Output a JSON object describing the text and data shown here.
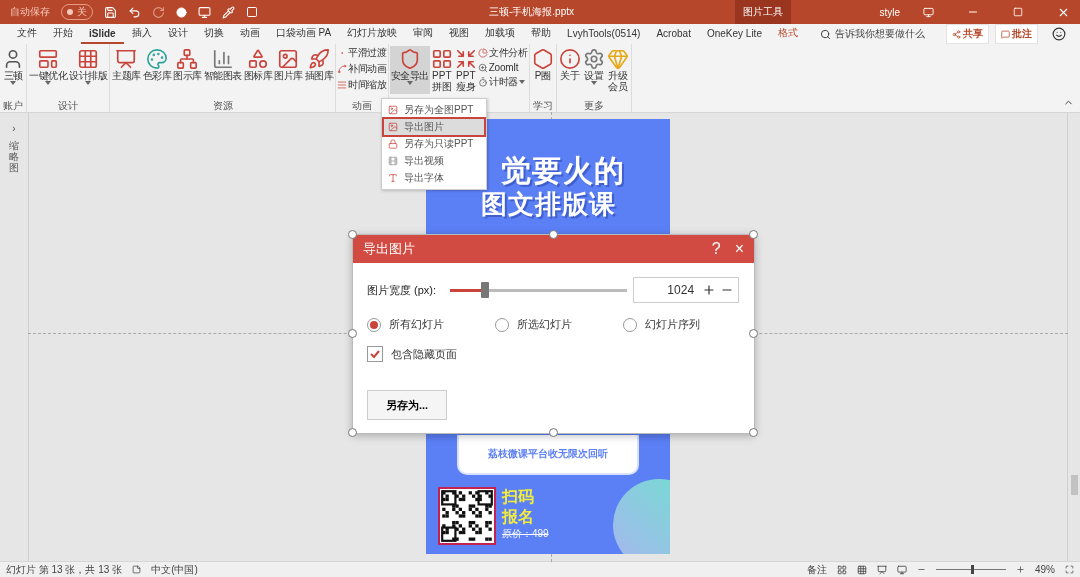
{
  "title_bar": {
    "autosave_label": "自动保存",
    "autosave_toggle": {
      "label": "关",
      "on": false
    },
    "document_title": "三顿-手机海报.pptx",
    "context_label": "图片工具",
    "user": "style"
  },
  "tabs": [
    {
      "label": "文件",
      "selected": false,
      "kind": "normal"
    },
    {
      "label": "开始",
      "selected": false,
      "kind": "normal"
    },
    {
      "label": "iSlide",
      "selected": true,
      "kind": "normal"
    },
    {
      "label": "插入",
      "selected": false,
      "kind": "normal"
    },
    {
      "label": "设计",
      "selected": false,
      "kind": "normal"
    },
    {
      "label": "切换",
      "selected": false,
      "kind": "normal"
    },
    {
      "label": "动画",
      "selected": false,
      "kind": "normal"
    },
    {
      "label": "口袋动画 PA",
      "selected": false,
      "kind": "normal"
    },
    {
      "label": "幻灯片放映",
      "selected": false,
      "kind": "normal"
    },
    {
      "label": "审阅",
      "selected": false,
      "kind": "normal"
    },
    {
      "label": "视图",
      "selected": false,
      "kind": "normal"
    },
    {
      "label": "加载项",
      "selected": false,
      "kind": "normal"
    },
    {
      "label": "帮助",
      "selected": false,
      "kind": "normal"
    },
    {
      "label": "LvyhTools(0514)",
      "selected": false,
      "kind": "normal"
    },
    {
      "label": "Acrobat",
      "selected": false,
      "kind": "normal"
    },
    {
      "label": "OneKey Lite",
      "selected": false,
      "kind": "normal"
    },
    {
      "label": "格式",
      "selected": false,
      "kind": "context"
    }
  ],
  "search": {
    "placeholder": "告诉我你想要做什么"
  },
  "actions": [
    "共享",
    "批注"
  ],
  "ribbon": {
    "groups": [
      {
        "label": "账户",
        "items": [
          {
            "label": "三顿",
            "kind": "large",
            "dropdown": true
          }
        ]
      },
      {
        "label": "设计",
        "items": [
          {
            "label": "一键优化",
            "kind": "large",
            "dropdown": true
          },
          {
            "label": "设计排版",
            "kind": "large",
            "dropdown": true
          }
        ]
      },
      {
        "label": "资源",
        "items": [
          {
            "label": "主题库",
            "kind": "large",
            "dropdown": false
          },
          {
            "label": "色彩库",
            "kind": "large",
            "dropdown": false
          },
          {
            "label": "图示库",
            "kind": "large",
            "dropdown": false
          },
          {
            "label": "智能图表",
            "kind": "large",
            "dropdown": false
          },
          {
            "label": "图标库",
            "kind": "large",
            "dropdown": false
          },
          {
            "label": "图片库",
            "kind": "large",
            "dropdown": false
          },
          {
            "label": "插图库",
            "kind": "large",
            "dropdown": false
          }
        ]
      },
      {
        "label": "动画",
        "items": [
          {
            "label": "平滑过渡",
            "kind": "small",
            "dropdown": false
          },
          {
            "label": "补间动画",
            "kind": "small",
            "dropdown": false
          },
          {
            "label": "时间缩放",
            "kind": "small",
            "dropdown": false
          }
        ]
      },
      {
        "items": [
          {
            "label": "安全导出",
            "kind": "large",
            "dropdown": true,
            "selected": true
          },
          {
            "label": "PPT拼图",
            "kind": "large",
            "dropdown": false,
            "selected": false
          },
          {
            "label": "PPT瘦身",
            "kind": "large",
            "dropdown": false,
            "selected": false
          },
          {
            "label": "文件分析",
            "kind": "small",
            "dropdown": false
          },
          {
            "label": "ZoomIt",
            "kind": "small",
            "dropdown": false
          },
          {
            "label": "计时器",
            "kind": "small",
            "dropdown": true
          }
        ]
      },
      {
        "label": "学习",
        "items": [
          {
            "label": "P圈",
            "kind": "large",
            "dropdown": false
          }
        ]
      },
      {
        "label": "更多",
        "items": [
          {
            "label": "关于",
            "kind": "large",
            "dropdown": false
          },
          {
            "label": "设置",
            "kind": "large",
            "dropdown": true
          },
          {
            "label": "升级会员",
            "kind": "large",
            "dropdown": false
          }
        ]
      }
    ]
  },
  "dropdown_menu": {
    "items": [
      {
        "label": "另存为全图PPT",
        "selected": false
      },
      {
        "label": "导出图片",
        "selected": true
      },
      {
        "label": "另存为只读PPT",
        "selected": false
      },
      {
        "label": "导出视频",
        "selected": false
      },
      {
        "label": "导出字体",
        "selected": false
      }
    ]
  },
  "thumbnail_strip": {
    "toggle": "›",
    "label": "缩略图"
  },
  "slide": {
    "headline": [
      "觉要火的",
      "图文排版课"
    ],
    "card_note": "荔枝微课平台收无限次回听",
    "cta": [
      "扫码",
      "报名"
    ],
    "price": "原价：499"
  },
  "dialog": {
    "title": "导出图片",
    "help": "?",
    "close": "×",
    "width_label": "图片宽度 (px):",
    "width_slider": {
      "level": 0.2
    },
    "width_value": "1024",
    "radios": [
      {
        "label": "所有幻灯片",
        "selected": true
      },
      {
        "label": "所选幻灯片",
        "selected": false
      },
      {
        "label": "幻灯片序列",
        "selected": false
      }
    ],
    "checkbox": {
      "label": "包含隐藏页面",
      "checked": true
    },
    "save_button": "另存为..."
  },
  "status_bar": {
    "slide_info": "幻灯片 第 13 张，共 13 张",
    "language": "中文(中国)",
    "notes": "备注",
    "zoom": {
      "level": 0.5
    },
    "zoom_value": "49%"
  }
}
